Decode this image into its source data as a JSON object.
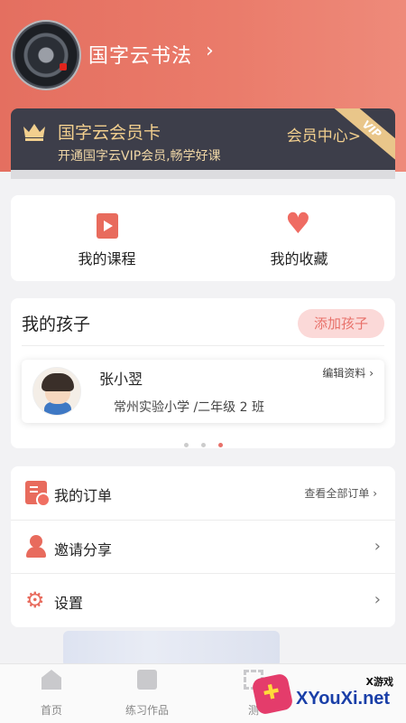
{
  "profile": {
    "name": "国字云书法"
  },
  "vip": {
    "title": "国字云会员卡",
    "subtitle": "开通国字云VIP会员,畅学好课",
    "link": "会员中心>",
    "ribbon": "VIP"
  },
  "quick_actions": [
    {
      "label": "我的课程"
    },
    {
      "label": "我的收藏"
    }
  ],
  "kids": {
    "title": "我的孩子",
    "add_button": "添加孩子",
    "child": {
      "name": "张小翌",
      "school": "常州实验小学 /二年级 2 班",
      "edit": "编辑资料 ›"
    }
  },
  "menu": {
    "orders": {
      "label": "我的订单",
      "action": "查看全部订单 ›"
    },
    "invite": {
      "label": "邀请分享"
    },
    "settings": {
      "label": "设置"
    }
  },
  "tabs": [
    {
      "label": "首页"
    },
    {
      "label": "练习作品"
    },
    {
      "label": "测"
    }
  ],
  "watermark": {
    "small": "X游戏",
    "text": "XYouXi.net"
  },
  "colors": {
    "accent": "#e86b5d",
    "vip_bg": "#3d3e4a",
    "gold": "#f2cf8e"
  }
}
